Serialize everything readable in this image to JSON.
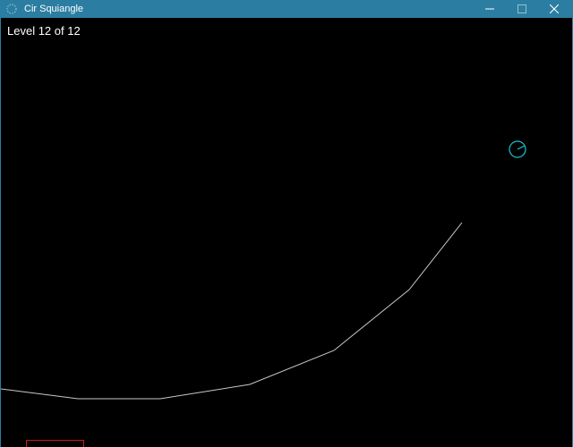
{
  "window": {
    "title": "Cir Squiangle",
    "titlebar_color": "#2b7ea1",
    "app_icon": "dotted-circle-icon",
    "controls": {
      "minimize_icon": "minimize-icon",
      "maximize_icon": "maximize-icon",
      "close_icon": "close-icon",
      "maximize_enabled": false
    }
  },
  "game": {
    "background_color": "#000000",
    "level_text": "Level 12 of 12",
    "player": {
      "shape": "circle",
      "color": "#19c6d1",
      "icon": "player-circle-icon"
    },
    "terrain": {
      "color": "#c8c8c8"
    },
    "goal": {
      "color": "#cc1a1a"
    }
  }
}
